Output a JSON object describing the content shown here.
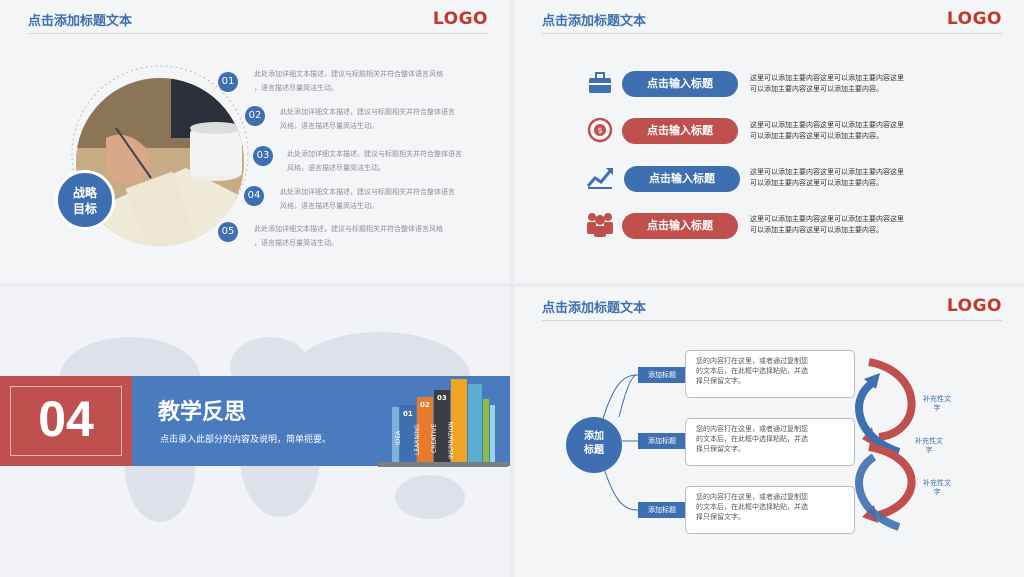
{
  "slide1": {
    "title": "点击添加标题文本",
    "logo": "LOGO",
    "center_label": [
      "战略",
      "目标"
    ],
    "items": [
      {
        "num": "01",
        "line1": "此处添加详细文本描述，建议与标题相关并符合整体语言风格",
        "line2": "，语言描述尽量简洁生动。"
      },
      {
        "num": "02",
        "line1": "此处添加详细文本描述，建议与标题相关并符合整体语言",
        "line2": "风格，语言描述尽量简洁生动。"
      },
      {
        "num": "03",
        "line1": "此处添加详细文本描述，建议与标题相关并符合整体语言",
        "line2": "风格，语言描述尽量简洁生动。"
      },
      {
        "num": "04",
        "line1": "此处添加详细文本描述，建议与标题相关并符合整体语言",
        "line2": "风格，语言描述尽量简洁生动。"
      },
      {
        "num": "05",
        "line1": "此处添加详细文本描述，建议与标题相关并符合整体语言风格",
        "line2": "，语言描述尽量简洁生动。"
      }
    ]
  },
  "slide2": {
    "title": "点击添加标题文本",
    "logo": "LOGO",
    "rows": [
      {
        "icon": "briefcase-icon",
        "label": "点击输入标题",
        "color": "#3e6fb0",
        "desc1": "这里可以添加主要内容这里可以添加主要内容这里",
        "desc2": "可以添加主要内容这里可以添加主要内容。"
      },
      {
        "icon": "clock-dollar-icon",
        "label": "点击输入标题",
        "color": "#c0504d",
        "desc1": "这里可以添加主要内容这里可以添加主要内容这里",
        "desc2": "可以添加主要内容这里可以添加主要内容。"
      },
      {
        "icon": "chart-arrow-icon",
        "label": "点击输入标题",
        "color": "#3e6fb0",
        "desc1": "这里可以添加主要内容这里可以添加主要内容这里",
        "desc2": "可以添加主要内容这里可以添加主要内容。"
      },
      {
        "icon": "team-icon",
        "label": "点击输入标题",
        "color": "#c0504d",
        "desc1": "这里可以添加主要内容这里可以添加主要内容这里",
        "desc2": "可以添加主要内容这里可以添加主要内容。"
      }
    ]
  },
  "slide3": {
    "number": "04",
    "heading": "教学反思",
    "subtitle": "点击录入此部分的内容及说明，简单扼要。",
    "books": [
      "IDEA",
      "LEARNING",
      "CREATIVE",
      "INSPIRATION",
      "01",
      "02",
      "03"
    ]
  },
  "slide4": {
    "title": "点击添加标题文本",
    "logo": "LOGO",
    "center": [
      "添加",
      "标题"
    ],
    "branches": [
      {
        "tag": "添加标题",
        "lines": [
          "您的内容打在这里，或者通过复制您",
          "的文本后，在此框中选择粘贴，并选",
          "择只保留文字。"
        ]
      },
      {
        "tag": "添加标题",
        "lines": [
          "您的内容打在这里，或者通过复制您",
          "的文本后，在此框中选择粘贴，并选",
          "择只保留文字。"
        ]
      },
      {
        "tag": "添加标题",
        "lines": [
          "您的内容打在这里，或者通过复制您",
          "的文本后，在此框中选择粘贴，并选",
          "择只保留文字。"
        ]
      }
    ],
    "side_labels": [
      [
        "补充性文",
        "字"
      ],
      [
        "补充性文",
        "字"
      ],
      [
        "补充性文",
        "字"
      ]
    ]
  }
}
